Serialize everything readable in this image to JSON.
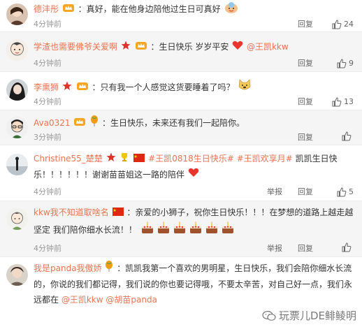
{
  "comments": [
    {
      "name": "德沣彤",
      "segments": [
        "：真好，能在他身边陪他过生日可真好"
      ],
      "time": "4分钟前",
      "reply": "回复",
      "likes": "24"
    },
    {
      "name": "学渣也需要佛爷关爱啊",
      "segments": [
        "：生日快乐 岁岁平安",
        "@王凯kkw"
      ],
      "time": "4分钟前",
      "reply": "回复",
      "likes": "9"
    },
    {
      "name": "李熏狮",
      "segments": [
        "：只有我一个人感觉这货要睡着了吗？"
      ],
      "time": "4分钟前",
      "reply": "回复",
      "likes": "13"
    },
    {
      "name": "Ava0321",
      "segments": [
        "：生日快乐，未来还有我们一起陪你。"
      ],
      "time": "3分钟前",
      "reply": "回复",
      "likes": ""
    },
    {
      "name": "Christine55_楚楚",
      "topics": [
        "#王凯0818生日快乐#",
        "#王凯欢享月#"
      ],
      "segments": [
        "凯凯生日快乐！！！！！！谢谢苗苗姐这一路的陪伴"
      ],
      "time": "4分钟前",
      "report": "举报",
      "reply": "回复",
      "likes": "5"
    },
    {
      "name": "kkw我不知道取啥名",
      "segments": [
        "：亲爱的小狮子，祝你生日快乐！！！在梦想的道路上越走越坚定 我们陪你细水长流！！"
      ],
      "time": "4分钟前",
      "report": "举报",
      "reply": "回复",
      "likes": ""
    },
    {
      "name": "我是panda我傲娇",
      "segments": [
        "：凯凯我第一个喜欢的男明星，生日快乐，我们会陪你细水长流的，你说的我们都记得，我们说的你也要记得哦，不要太辛苦，对自己好一点，我们永远都在",
        "@王凯kkw",
        "@胡苗panda"
      ],
      "time": "4分钟前",
      "reply": "回复",
      "likes": ""
    }
  ],
  "watermark": "玩票儿DE鲱鲮明",
  "icons": {
    "like": "thumb-up-icon",
    "vip": "crown-badge-icon",
    "flag": "china-flag-icon",
    "star": "red-star-icon",
    "cake": "cake-emoji-icon",
    "heart": "heart-emoji-icon"
  },
  "colors": {
    "name": "#eb7350",
    "text": "#333333",
    "meta": "#999999"
  }
}
